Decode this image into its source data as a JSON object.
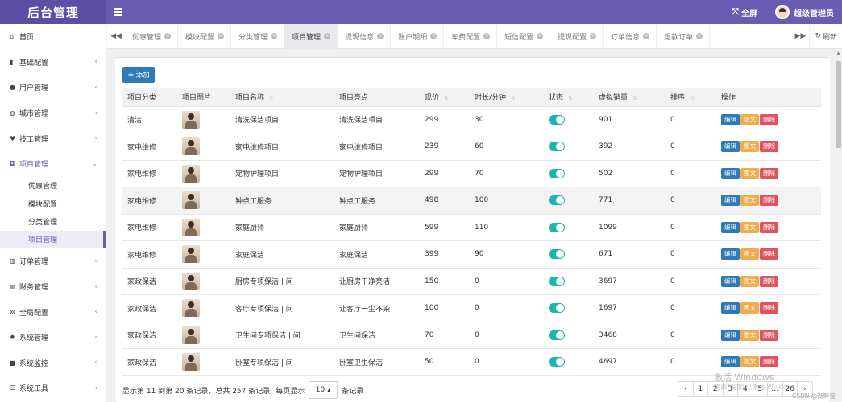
{
  "header": {
    "brand": "后台管理",
    "fullscreen_label": "全屏",
    "username": "超级管理员"
  },
  "sidebar": {
    "items": [
      {
        "label": "首页",
        "icon": "home-icon",
        "glyph": "⌂",
        "has_children": false
      },
      {
        "label": "基础配置",
        "icon": "bookmark-icon",
        "glyph": "▮",
        "has_children": true
      },
      {
        "label": "用户管理",
        "icon": "user-icon",
        "glyph": "●",
        "has_children": true
      },
      {
        "label": "城市管理",
        "icon": "globe-icon",
        "glyph": "◍",
        "has_children": true
      },
      {
        "label": "技工管理",
        "icon": "heart-icon",
        "glyph": "♥",
        "has_children": true
      },
      {
        "label": "项目管理",
        "icon": "puzzle-icon",
        "glyph": "◘",
        "has_children": true,
        "open": true
      }
    ],
    "sub_items": [
      {
        "label": "优惠管理"
      },
      {
        "label": "模块配置"
      },
      {
        "label": "分类管理"
      },
      {
        "label": "项目管理",
        "active": true
      }
    ],
    "items_after": [
      {
        "label": "订单管理",
        "icon": "bar-chart-icon",
        "glyph": "▥",
        "has_children": true
      },
      {
        "label": "财务管理",
        "icon": "coins-icon",
        "glyph": "▤",
        "has_children": true
      },
      {
        "label": "全局配置",
        "icon": "cogs-icon",
        "glyph": "✲",
        "has_children": true
      },
      {
        "label": "系统管理",
        "icon": "gear-icon",
        "glyph": "✹",
        "has_children": true
      },
      {
        "label": "系统监控",
        "icon": "video-icon",
        "glyph": "■",
        "has_children": true
      },
      {
        "label": "系统工具",
        "icon": "list-icon",
        "glyph": "☰",
        "has_children": true
      }
    ]
  },
  "tabs": [
    {
      "label": "优惠管理"
    },
    {
      "label": "模块配置"
    },
    {
      "label": "分类管理"
    },
    {
      "label": "项目管理",
      "active": true
    },
    {
      "label": "提现信息"
    },
    {
      "label": "账户明细"
    },
    {
      "label": "车费配置"
    },
    {
      "label": "短信配置"
    },
    {
      "label": "提现配置"
    },
    {
      "label": "订单信息"
    },
    {
      "label": "退款订单"
    }
  ],
  "tabs_refresh_label": "刷新",
  "toolbar": {
    "add_label": "添加"
  },
  "table": {
    "columns": [
      "项目分类",
      "项目图片",
      "项目名称",
      "项目亮点",
      "现价",
      "时长/分钟",
      "状态",
      "虚拟销量",
      "排序",
      "操作"
    ],
    "sortable": [
      false,
      false,
      true,
      false,
      true,
      true,
      true,
      true,
      true,
      false
    ],
    "rows": [
      {
        "category": "清洁",
        "name": "清洗保洁项目",
        "highlight": "清洗保洁项目",
        "price": "299",
        "duration": "30",
        "status": true,
        "sales": "901",
        "sort": "0"
      },
      {
        "category": "家电维修",
        "name": "家电维修项目",
        "highlight": "家电维修项目",
        "price": "239",
        "duration": "60",
        "status": true,
        "sales": "392",
        "sort": "0"
      },
      {
        "category": "家电维修",
        "name": "宠物护理项目",
        "highlight": "宠物护理项目",
        "price": "299",
        "duration": "70",
        "status": true,
        "sales": "502",
        "sort": "0"
      },
      {
        "category": "家电维修",
        "name": "钟点工服务",
        "highlight": "钟点工服务",
        "price": "498",
        "duration": "100",
        "status": true,
        "sales": "771",
        "sort": "0",
        "highlighted": true
      },
      {
        "category": "家电维修",
        "name": "家庭厨师",
        "highlight": "家庭厨师",
        "price": "599",
        "duration": "110",
        "status": true,
        "sales": "1099",
        "sort": "0"
      },
      {
        "category": "家电维修",
        "name": "家庭保洁",
        "highlight": "家庭保洁",
        "price": "399",
        "duration": "90",
        "status": true,
        "sales": "671",
        "sort": "0"
      },
      {
        "category": "家政保洁",
        "name": "厨房专项保洁 | 间",
        "highlight": "让厨房干净亮洁",
        "price": "150",
        "duration": "0",
        "status": true,
        "sales": "3697",
        "sort": "0"
      },
      {
        "category": "家政保洁",
        "name": "客厅专项保洁 | 间",
        "highlight": "让客厅一尘不染",
        "price": "100",
        "duration": "0",
        "status": true,
        "sales": "1697",
        "sort": "0"
      },
      {
        "category": "家政保洁",
        "name": "卫生间专项保洁 | 间",
        "highlight": "卫生间保洁",
        "price": "70",
        "duration": "0",
        "status": true,
        "sales": "3468",
        "sort": "0"
      },
      {
        "category": "家政保洁",
        "name": "卧室专项保洁 | 间",
        "highlight": "卧室卫生保洁",
        "price": "50",
        "duration": "0",
        "status": true,
        "sales": "4697",
        "sort": "0"
      }
    ],
    "actions": {
      "edit": "编辑",
      "text": "图文",
      "delete": "删除"
    }
  },
  "pagination": {
    "summary": "显示第 11 到第 20 条记录，总共 257 条记录",
    "per_page_prefix": "每页显示",
    "per_page_value": "10",
    "per_page_suffix": "条记录",
    "pages": [
      "‹",
      "1",
      "2",
      "3",
      "4",
      "5",
      "…",
      "26",
      "›"
    ]
  },
  "watermarks": {
    "windows_line1": "激活 Windows",
    "windows_line2": "转到\"设置\"以激活 Windows",
    "csdn": "CSDN @湖畔宝"
  },
  "colors": {
    "header_purple": "#6a5cb2",
    "brand_purple": "#5c4ea4",
    "primary_blue": "#2e7ab8",
    "warning_orange": "#f0ad4e",
    "danger_red": "#e0535f",
    "toggle_teal": "#1ab5b0"
  }
}
